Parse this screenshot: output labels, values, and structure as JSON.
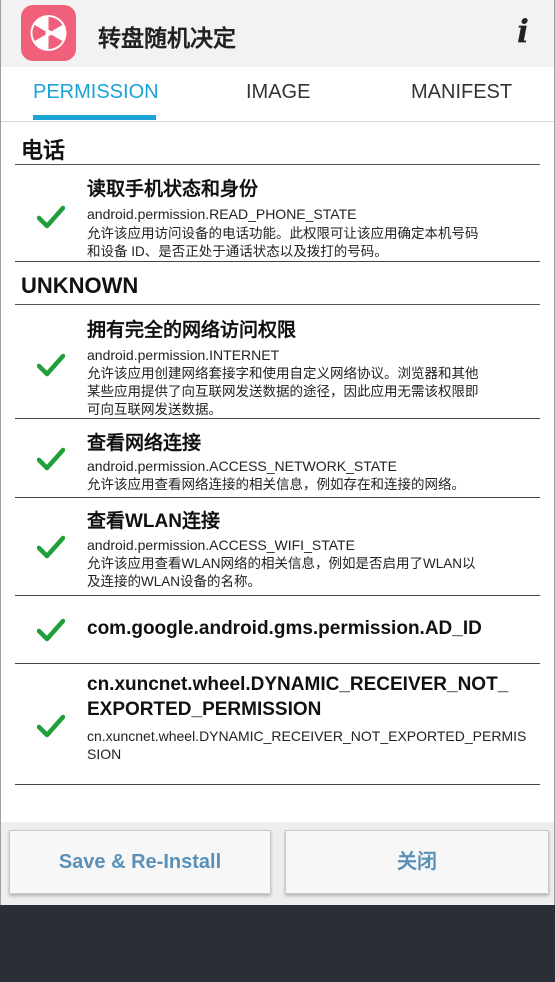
{
  "header": {
    "title": "转盘随机决定",
    "info_label": "i"
  },
  "tabs": [
    {
      "label": "PERMISSION",
      "active": true
    },
    {
      "label": "IMAGE",
      "active": false
    },
    {
      "label": "MANIFEST",
      "active": false
    }
  ],
  "sections": [
    {
      "title": "电话",
      "permissions": [
        {
          "title": "读取手机状态和身份",
          "id": "android.permission.READ_PHONE_STATE",
          "desc_lines": [
            "允许该应用访问设备的电话功能。此权限可让该应用确定本机号码",
            "和设备 ID、是否正处于通话状态以及拨打的号码。"
          ]
        }
      ]
    },
    {
      "title": "UNKNOWN",
      "permissions": [
        {
          "title": "拥有完全的网络访问权限",
          "id": "android.permission.INTERNET",
          "desc_lines": [
            "允许该应用创建网络套接字和使用自定义网络协议。浏览器和其他",
            "某些应用提供了向互联网发送数据的途径，因此应用无需该权限即",
            "可向互联网发送数据。"
          ]
        },
        {
          "title": "查看网络连接",
          "id": "android.permission.ACCESS_NETWORK_STATE",
          "desc_lines": [
            "允许该应用查看网络连接的相关信息，例如存在和连接的网络。"
          ]
        },
        {
          "title": "查看WLAN连接",
          "id": "android.permission.ACCESS_WIFI_STATE",
          "desc_lines": [
            "允许该应用查看WLAN网络的相关信息，例如是否启用了WLAN以",
            "及连接的WLAN设备的名称。"
          ]
        },
        {
          "title": "com.google.android.gms.permission.AD_ID"
        },
        {
          "title_lines": [
            "cn.xuncnet.wheel.DYNAMIC_RECEIVER_NOT_",
            "EXPORTED_PERMISSION"
          ],
          "id_lines": [
            "cn.xuncnet.wheel.DYNAMIC_RECEIVER_NOT_EXPORTED_PERMIS",
            "SION"
          ]
        }
      ]
    }
  ],
  "footer": {
    "save_label": "Save & Re-Install",
    "close_label": "关闭"
  },
  "colors": {
    "accent": "#1aa3d6",
    "check": "#1f9e3a",
    "button_text": "#5a90b8",
    "app_icon": "#f0607a"
  },
  "icons": {
    "app": "wheel-icon",
    "check": "checkmark-icon"
  }
}
